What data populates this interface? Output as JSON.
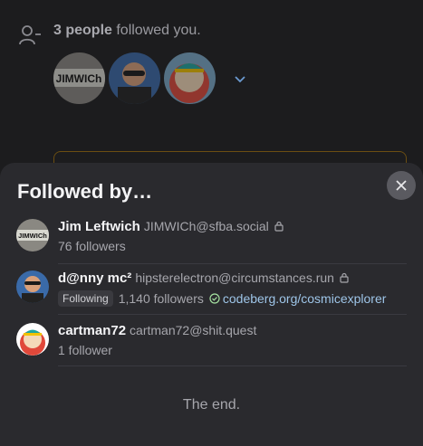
{
  "notification": {
    "count_text": "3 people",
    "action_text": " followed you.",
    "icon": "person-add-icon",
    "avatar_labels": [
      "JIMWICh"
    ]
  },
  "sheet": {
    "title": "Followed by…",
    "close_icon": "close-icon",
    "followers": [
      {
        "display_name": "Jim Leftwich",
        "account": "JIMWICh@sfba.social",
        "locked": true,
        "followers_text": "76 followers",
        "avatar_label": "JIMWICh"
      },
      {
        "display_name": "d@nny mc²",
        "account": "hipsterelectron@circumstances.run",
        "locked": true,
        "following_tag": "Following",
        "followers_text": "1,140 followers",
        "verified_link": "codeberg.org/cosmicexplorer"
      },
      {
        "display_name": "cartman72",
        "account": "cartman72@shit.quest",
        "locked": false,
        "followers_text": "1 follower"
      }
    ],
    "end_text": "The end."
  },
  "colors": {
    "background": "#1c1c1e",
    "sheet": "#2a2a2e",
    "link": "#9ec5e8",
    "verified": "#a6e3a1"
  }
}
